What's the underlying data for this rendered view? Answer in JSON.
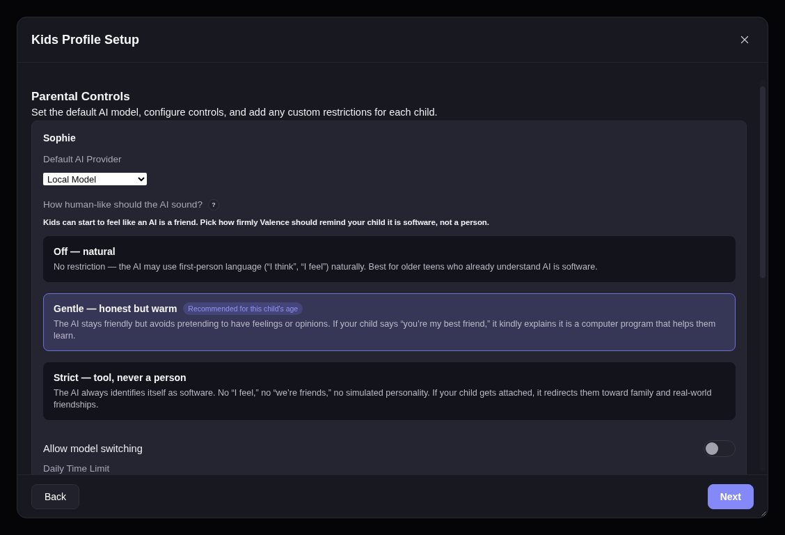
{
  "dialog": {
    "title": "Kids Profile Setup"
  },
  "section": {
    "title": "Parental Controls",
    "subtitle": "Set the default AI model, configure controls, and add any custom restrictions for each child."
  },
  "profiles": [
    {
      "name": "Sophie",
      "provider": {
        "label": "Default AI Provider",
        "value": "Local Model"
      },
      "humanlike": {
        "question": "How human-like should the AI sound?",
        "help": "?",
        "note": "Kids can start to feel like an AI is a friend. Pick how firmly Valence should remind your child it is software, not a person.",
        "options": [
          {
            "title": "Off — natural",
            "description": "No restriction — the AI may use first-person language (“I think”, “I feel”) naturally. Best for older teens who already understand AI is software.",
            "selected": false
          },
          {
            "title": "Gentle — honest but warm",
            "badge": "Recommended for this child's age",
            "description": "The AI stays friendly but avoids pretending to have feelings or opinions. If your child says “you’re my best friend,” it kindly explains it is a computer program that helps them learn.",
            "selected": true
          },
          {
            "title": "Strict — tool, never a person",
            "description": "The AI always identifies itself as software. No “I feel,” no “we’re friends,” no simulated personality. If your child gets attached, it redirects them toward family and real-world friendships.",
            "selected": false
          }
        ]
      },
      "settings": [
        {
          "kind": "toggle",
          "label": "Allow model switching",
          "on": false
        },
        {
          "kind": "heading",
          "label": "Daily Time Limit"
        }
      ]
    }
  ],
  "footer": {
    "buttons": [
      {
        "kind": "secondary",
        "label": "Back"
      },
      {
        "kind": "primary",
        "label": "Next"
      }
    ]
  }
}
